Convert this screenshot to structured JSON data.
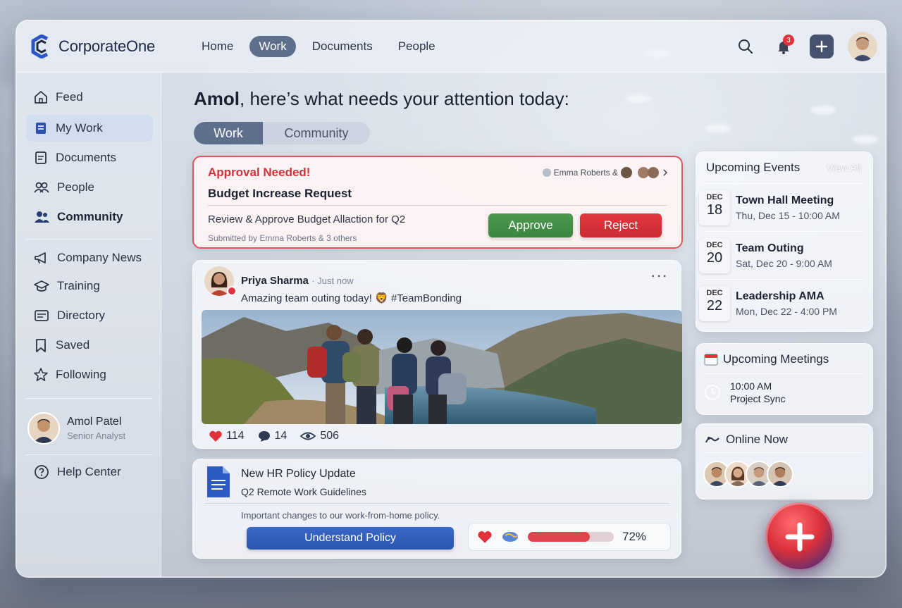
{
  "app": {
    "name": "CorporateOne"
  },
  "topnav": [
    {
      "label": "Home",
      "active": false
    },
    {
      "label": "Work",
      "active": true
    },
    {
      "label": "Documents",
      "active": false
    },
    {
      "label": "People",
      "active": false
    }
  ],
  "notifications": {
    "count": "3"
  },
  "sidebar": {
    "items": [
      {
        "label": "Feed",
        "icon": "home-icon"
      },
      {
        "label": "My Work",
        "icon": "document-icon",
        "active": true
      },
      {
        "label": "Documents",
        "icon": "file-icon"
      },
      {
        "label": "People",
        "icon": "people-icon"
      },
      {
        "label": "Community",
        "icon": "community-icon"
      },
      {
        "label": "Company News",
        "icon": "megaphone-icon"
      },
      {
        "label": "Training",
        "icon": "graduation-cap-icon"
      },
      {
        "label": "Directory",
        "icon": "directory-icon"
      },
      {
        "label": "Saved",
        "icon": "bookmark-icon"
      },
      {
        "label": "Following",
        "icon": "star-icon"
      }
    ],
    "user": {
      "name": "Amol Patel",
      "role": "Senior Analyst"
    },
    "help": "Help Center"
  },
  "main": {
    "greeting_name": "Amol",
    "greeting_rest": ", here’s what needs your attention today:",
    "tabs": [
      {
        "label": "Work",
        "active": true
      },
      {
        "label": "Community",
        "active": false
      }
    ],
    "approval": {
      "heading": "Approval Needed!",
      "title": "Budget Increase Request",
      "people_label": "Emma Roberts &",
      "description": "Review & Approve Budget Allaction for Q2",
      "submitted": "Submitted by Emma Roberts & 3 others",
      "approve_label": "Approve",
      "reject_label": "Reject"
    },
    "post": {
      "author": "Priya Sharma",
      "time": "· Just now",
      "text": "Amazing team outing today! 🦁 #TeamBonding",
      "likes": "114",
      "comments": "14",
      "views": "506"
    },
    "policy": {
      "title": "New HR Policy Update",
      "subtitle": "Q2 Remote Work Guidelines",
      "description": "Important changes to our work-from-home policy.",
      "button_label": "Understand Policy",
      "progress": 72,
      "progress_label": "72%"
    }
  },
  "right": {
    "events": {
      "title": "Upcoming Events",
      "view_all": "View All",
      "items": [
        {
          "month": "DEC",
          "day": "18",
          "title": "Town Hall Meeting",
          "time": "Thu, Dec 15 - 10:00 AM"
        },
        {
          "month": "DEC",
          "day": "20",
          "title": "Team Outing",
          "time": "Sat, Dec 20 - 9:00 AM"
        },
        {
          "month": "DEC",
          "day": "22",
          "title": "Leadership AMA",
          "time": "Mon, Dec 22 - 4:00 PM"
        }
      ]
    },
    "meetings": {
      "title": "Upcoming Meetings",
      "time": "10:00 AM",
      "name": "Project Sync"
    },
    "online": {
      "title": "Online Now"
    }
  },
  "colors": {
    "accent": "#5e6f8e",
    "approve": "#3c853f",
    "reject": "#c92a31",
    "alert": "#d0313a",
    "primary": "#2b55b0"
  }
}
